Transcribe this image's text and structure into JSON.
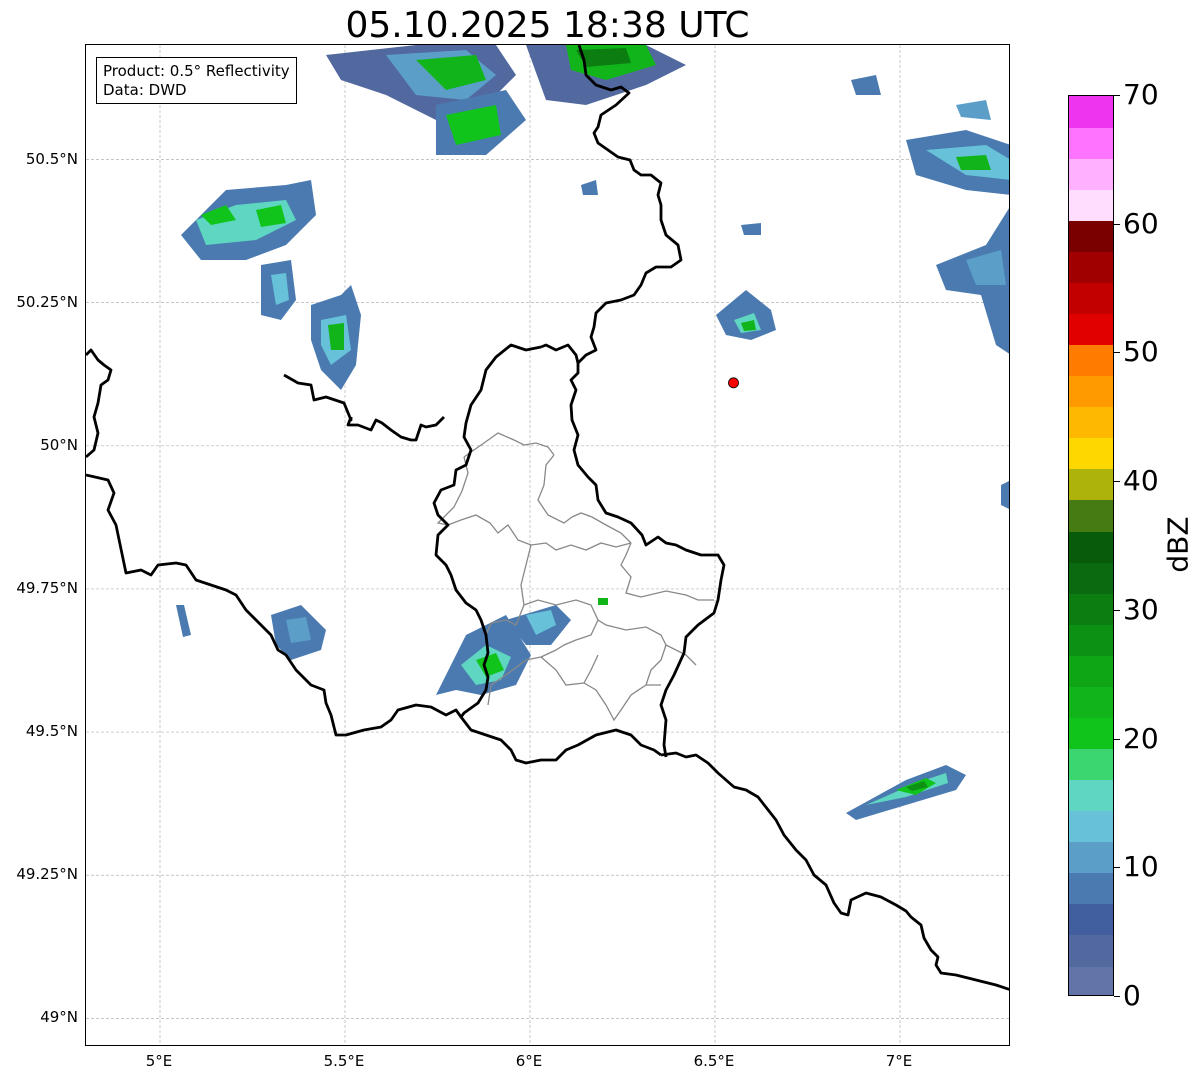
{
  "title": "05.10.2025 18:38 UTC",
  "info": {
    "product": "Product: 0.5° Reflectivity",
    "data_source": "Data: DWD"
  },
  "latitude_labels": [
    "50.5°N",
    "50.25°N",
    "50°N",
    "49.75°N",
    "49.5°N",
    "49.25°N",
    "49°N"
  ],
  "latitude_values": [
    50.5,
    50.25,
    50.0,
    49.75,
    49.5,
    49.25,
    49.0
  ],
  "longitude_labels": [
    "5°E",
    "5.5°E",
    "6°E",
    "6.5°E",
    "7°E"
  ],
  "longitude_values": [
    5.0,
    5.5,
    6.0,
    6.5,
    7.0
  ],
  "map_extent": {
    "lon_min": 4.8,
    "lon_max": 7.3,
    "lat_min": 48.95,
    "lat_max": 50.7
  },
  "marker": {
    "lon": 6.55,
    "lat": 50.11,
    "color": "#ff0000"
  },
  "colorbar": {
    "label": "dBZ",
    "min": 0,
    "max": 70,
    "tick_labels": [
      "0",
      "10",
      "20",
      "30",
      "40",
      "50",
      "60",
      "70"
    ],
    "tick_values": [
      0,
      10,
      20,
      30,
      40,
      50,
      60,
      70
    ],
    "colors": [
      "#6375a8",
      "#52699f",
      "#415e9f",
      "#4a7ab0",
      "#5b9fc8",
      "#66c1d9",
      "#5fd6c1",
      "#3cd670",
      "#11c41b",
      "#11b51a",
      "#0fa616",
      "#0d9114",
      "#0b7d11",
      "#0a6a0f",
      "#095b0c",
      "#467a13",
      "#adb30b",
      "#ffd700",
      "#ffb800",
      "#ff9b00",
      "#ff7c00",
      "#e00000",
      "#c20000",
      "#a00000",
      "#7a0000",
      "#ffddff",
      "#ffb1ff",
      "#ff74ff",
      "#ee34ee"
    ]
  },
  "colors": {
    "border_national": "#000000",
    "border_regional": "#888888",
    "grid": "#b4b4b4"
  }
}
